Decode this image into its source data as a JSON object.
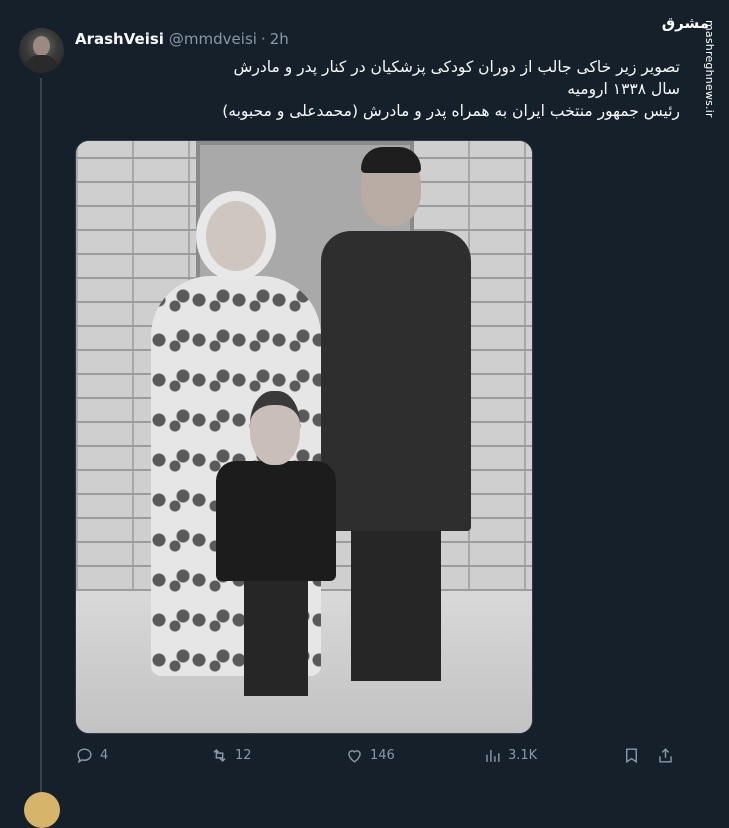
{
  "tweet": {
    "display_name": "ArashVeisi",
    "handle": "@mmdveisi",
    "separator": "·",
    "time": "2h",
    "text_lines": [
      "تصویر زیر خاکی جالب از دوران کودکی پزشکیان در کنار پدر و مادرش",
      "سال ۱۳۳۸ ارومیه",
      "رئیس جمهور منتخب ایران به همراه پدر و مادرش (محمدعلی و محبوبه)"
    ]
  },
  "actions": {
    "reply": {
      "icon": "reply-icon",
      "count": "4"
    },
    "retweet": {
      "icon": "retweet-icon",
      "count": "12"
    },
    "like": {
      "icon": "heart-icon",
      "count": "146"
    },
    "views": {
      "icon": "views-icon",
      "count": "3.1K"
    },
    "bookmark": {
      "icon": "bookmark-icon"
    },
    "share": {
      "icon": "share-icon"
    }
  },
  "watermark": {
    "logo_text": "مشرق",
    "url": "mashreghnews.ir"
  },
  "colors": {
    "background": "#15202b",
    "text": "#f7f9f9",
    "muted": "#8b98a5",
    "thread_line": "#38444d"
  }
}
